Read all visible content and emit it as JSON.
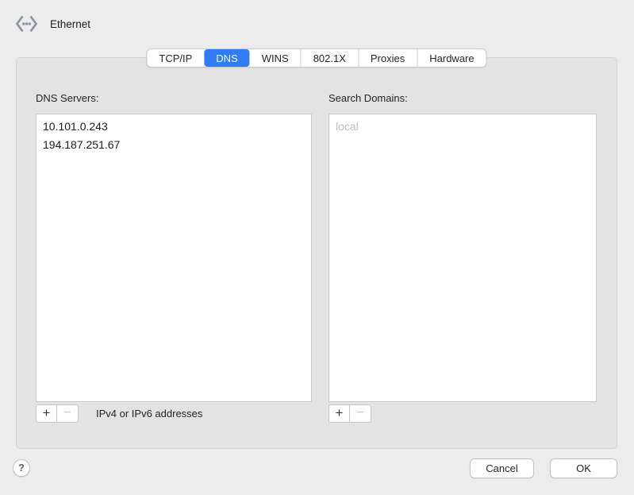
{
  "window": {
    "title": "Ethernet"
  },
  "tabs": {
    "items": [
      {
        "label": "TCP/IP",
        "selected": false
      },
      {
        "label": "DNS",
        "selected": true
      },
      {
        "label": "WINS",
        "selected": false
      },
      {
        "label": "802.1X",
        "selected": false
      },
      {
        "label": "Proxies",
        "selected": false
      },
      {
        "label": "Hardware",
        "selected": false
      }
    ]
  },
  "dns_servers": {
    "label": "DNS Servers:",
    "entries": [
      "10.101.0.243",
      "194.187.251.67"
    ],
    "hint": "IPv4 or IPv6 addresses",
    "add_label": "+",
    "remove_label": "−"
  },
  "search_domains": {
    "label": "Search Domains:",
    "placeholder": "local",
    "add_label": "+",
    "remove_label": "−"
  },
  "footer": {
    "help_label": "?",
    "cancel_label": "Cancel",
    "ok_label": "OK"
  },
  "colors": {
    "accent": "#2f7cf5",
    "window_bg": "#ececec",
    "panel_bg": "#e3e3e3",
    "list_bg": "#ffffff",
    "placeholder_text": "#bcbcbc",
    "ethernet_icon": "#8b95a5"
  }
}
